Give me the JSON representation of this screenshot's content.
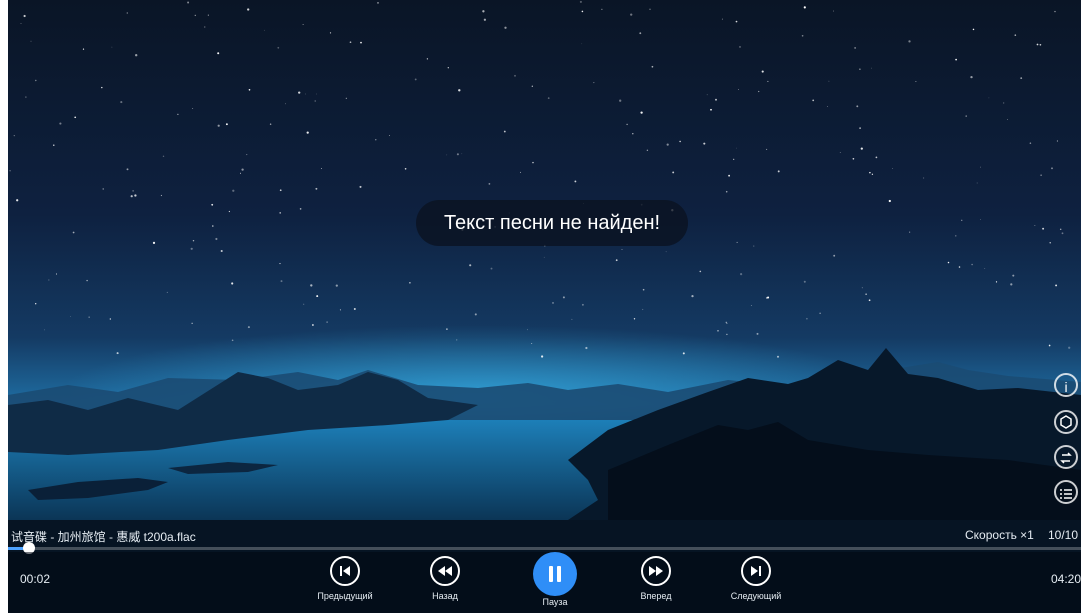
{
  "lyrics_toast": "Текст песни не найден!",
  "track": {
    "title": "试音碟 - 加州旅馆 - 惠威 t200a.flac",
    "current_time": "00:02",
    "total_time": "04:20",
    "progress_fraction": 0.008,
    "speed_label": "Скорость ×1",
    "playlist_position": "10/10"
  },
  "controls": {
    "previous_label": "Предыдущий",
    "rewind_label": "Назад",
    "pause_label": "Пауза",
    "forward_label": "Вперед",
    "next_label": "Следующий"
  },
  "side_icons": [
    "info-icon",
    "speed-dial-icon",
    "repeat-icon",
    "playlist-icon"
  ],
  "colors": {
    "accent": "#2f8ef7",
    "progress": "#4da3ff"
  }
}
